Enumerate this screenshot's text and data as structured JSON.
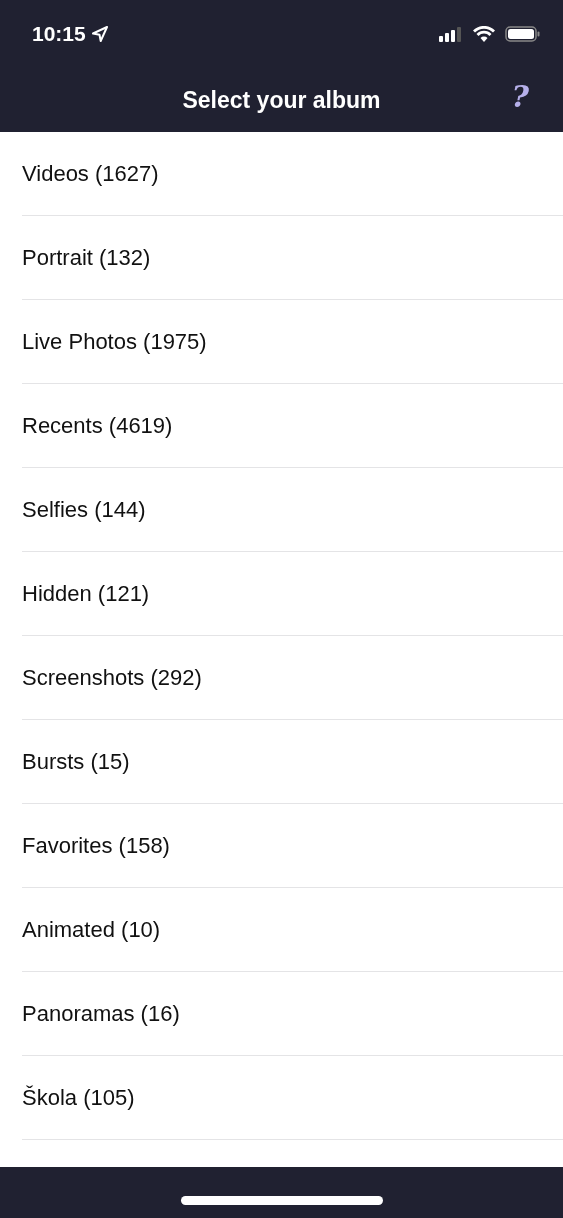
{
  "status_bar": {
    "time": "10:15"
  },
  "nav_bar": {
    "title": "Select your album",
    "help_button": "?"
  },
  "albums": [
    {
      "label": "Videos (1627)"
    },
    {
      "label": "Portrait (132)"
    },
    {
      "label": "Live Photos (1975)"
    },
    {
      "label": "Recents (4619)"
    },
    {
      "label": "Selfies (144)"
    },
    {
      "label": "Hidden (121)"
    },
    {
      "label": "Screenshots (292)"
    },
    {
      "label": "Bursts (15)"
    },
    {
      "label": "Favorites (158)"
    },
    {
      "label": "Animated (10)"
    },
    {
      "label": "Panoramas (16)"
    },
    {
      "label": "Škola (105)"
    }
  ]
}
